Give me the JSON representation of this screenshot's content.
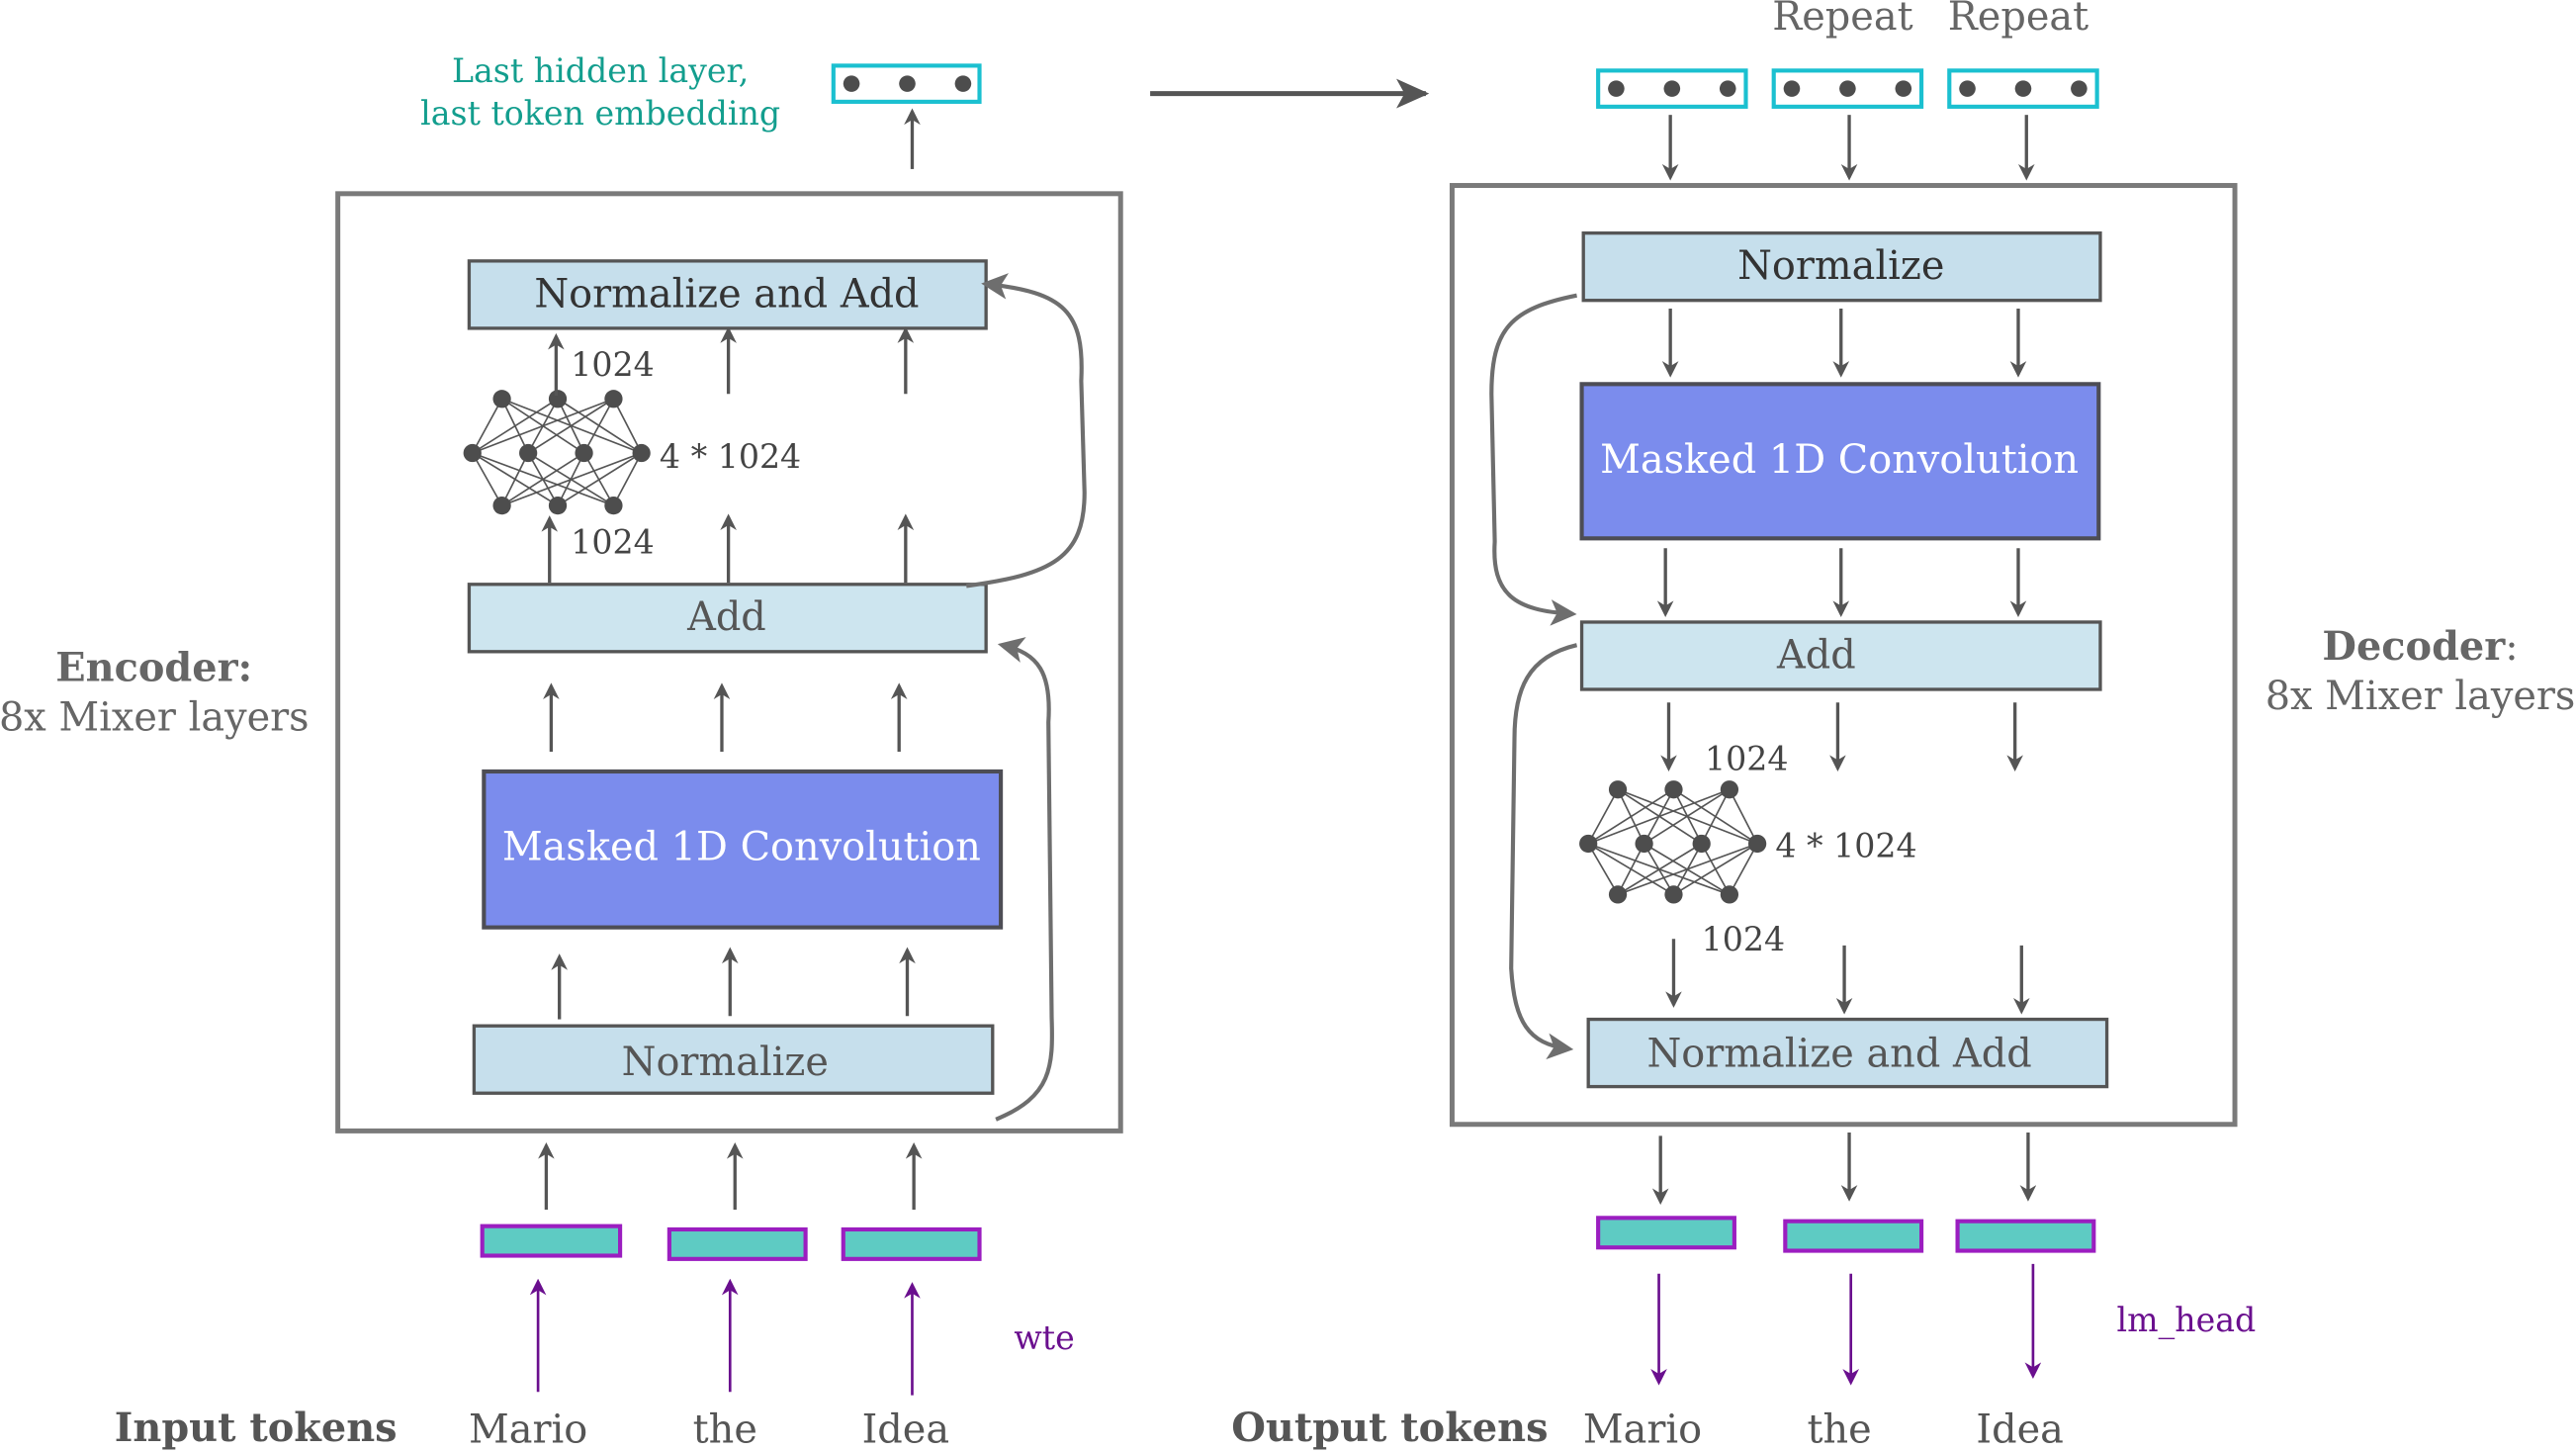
{
  "top_label": {
    "line1": "Last hidden layer,",
    "line2": "last token embedding"
  },
  "encoder": {
    "title": "Encoder:",
    "subtitle": "8x Mixer layers",
    "normalize_add": "Normalize and Add",
    "add": "Add",
    "conv": "Masked 1D Convolution",
    "normalize": "Normalize",
    "nn_out": "1024",
    "nn_hidden": "4 * 1024",
    "nn_in": "1024"
  },
  "decoder": {
    "title": "Decoder",
    "title_suffix": ":",
    "subtitle": "8x Mixer layers",
    "normalize": "Normalize",
    "conv": "Masked 1D Convolution",
    "add": "Add",
    "normalize_add": "Normalize and Add",
    "nn_in": "1024",
    "nn_hidden": "4 * 1024",
    "nn_out": "1024",
    "repeat_labels": [
      "Repeat",
      "Repeat"
    ]
  },
  "input": {
    "label": "Input tokens",
    "tokens": [
      "Mario",
      "the",
      "Idea"
    ],
    "embedding_label": "wte"
  },
  "output": {
    "label": "Output tokens",
    "tokens": [
      "Mario",
      "the",
      "Idea"
    ],
    "head_label": "lm_head"
  },
  "colors": {
    "conv": "#7b8ced",
    "box": "#c6dfec",
    "embedding_outline": "#1bc0d0",
    "token_fill": "#5ecbc3",
    "token_outline": "#9b1ec0",
    "teal_text": "#139e8e",
    "purple": "#6a0f8e"
  }
}
